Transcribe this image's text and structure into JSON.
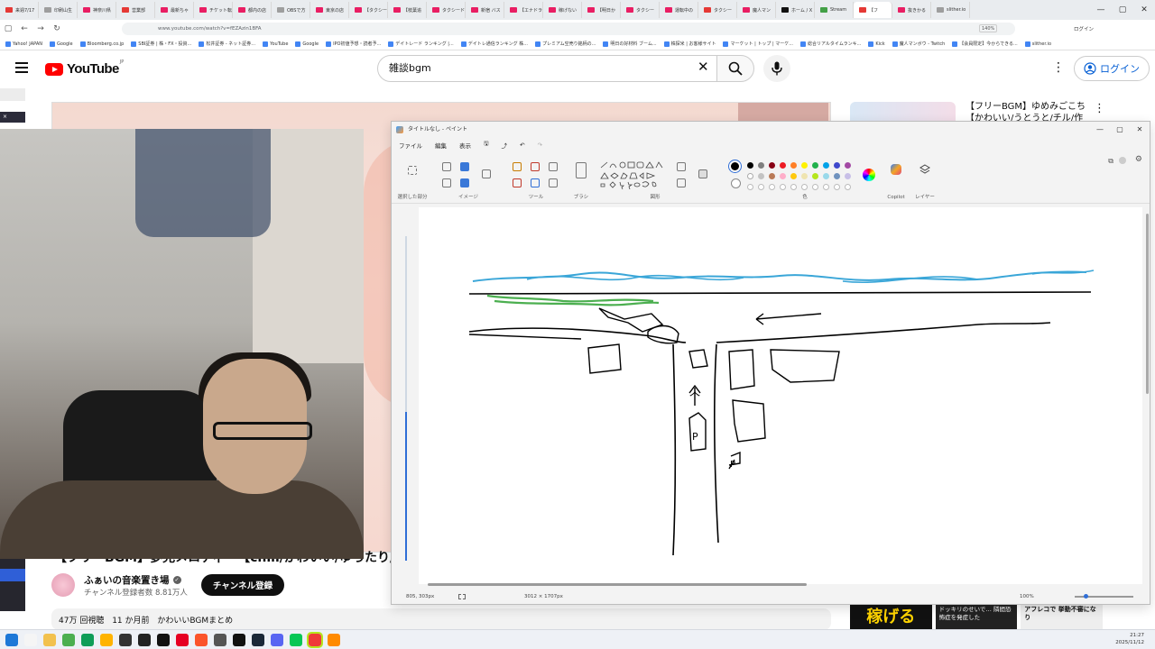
{
  "browser": {
    "tabs": [
      {
        "label": "来週7/17",
        "color": "#e53935"
      },
      {
        "label": "印刷山生",
        "color": "#9e9e9e"
      },
      {
        "label": "神奈川県",
        "color": "#e91e63"
      },
      {
        "label": "営業部",
        "color": "#e53935"
      },
      {
        "label": "最新ちゃ",
        "color": "#e91e63"
      },
      {
        "label": "チケット転",
        "color": "#e91e63"
      },
      {
        "label": "都内の店",
        "color": "#e91e63"
      },
      {
        "label": "OBSで方",
        "color": "#9e9e9e"
      },
      {
        "label": "東京の店",
        "color": "#e91e63"
      },
      {
        "label": "【タクシー",
        "color": "#e91e63"
      },
      {
        "label": "【枝葉追",
        "color": "#e91e63"
      },
      {
        "label": "タクシード",
        "color": "#e91e63"
      },
      {
        "label": "新宿 バス",
        "color": "#e91e63"
      },
      {
        "label": "【エナドラ",
        "color": "#e91e63"
      },
      {
        "label": "稼げない",
        "color": "#e91e63"
      },
      {
        "label": "【明日か",
        "color": "#e91e63"
      },
      {
        "label": "タクシー",
        "color": "#e91e63"
      },
      {
        "label": "運転中の",
        "color": "#e91e63"
      },
      {
        "label": "タクシー",
        "color": "#e53935"
      },
      {
        "label": "魔人マン",
        "color": "#e91e63"
      },
      {
        "label": "ホーム / X",
        "color": "#111111"
      },
      {
        "label": "Stream",
        "color": "#43a047"
      },
      {
        "label": "【フ",
        "color": "#e53935",
        "active": true
      },
      {
        "label": "抜きかる",
        "color": "#e91e63"
      },
      {
        "label": "slither.io",
        "color": "#9e9e9e"
      }
    ],
    "url": "www.youtube.com/watch?v=fEZAzin1BFA",
    "zoom": "140%",
    "profile_label": "ログイン",
    "bookmarks": [
      "Yahoo! JAPAN",
      "Google",
      "Bloomberg.co.jp",
      "SBI証券 | 株・FX・投資...",
      "松井証券 - ネット証券...",
      "YouTube",
      "Google",
      "IPO初値予想・読者予...",
      "デイトレード ランキング |...",
      "デイトレ通信ランキング 株...",
      "プレミアム空売り銘柄の...",
      "明日の好材料 ブーム...",
      "株探米 | お客様サイト",
      "マーケット | トップ | マーケ...",
      "総合リアルタイムランキ...",
      "Kick",
      "魔人マンボウ - Twitch",
      "【会員限定】今からできる...",
      "slither.io"
    ]
  },
  "youtube": {
    "logo_text": "YouTube",
    "region": "JP",
    "search_value": "雑談bgm",
    "login_label": "ログイン",
    "video_title": "【フリーBGM】夢見メロディー【chill/かわいい/ゆったり/",
    "channel_name": "ふぁいの音楽置き場",
    "subscriber_text": "チャンネル登録者数 8.81万人",
    "subscribe_label": "チャンネル登録",
    "views": "47万 回視聴",
    "posted": "11 か月前",
    "tags": "かわいいBGMまとめ",
    "rec_title": "【フリーBGM】ゆめみごこち【かわいい/うとうと/チル/作",
    "rec_bottom": [
      "稼げる",
      "ドッキリのせいで… 隣間恐怖症を発症した",
      "アフレコで 挙動不審になり"
    ]
  },
  "side_strip": {
    "label": "×"
  },
  "paint": {
    "title": "タイトルなし - ペイント",
    "menu": [
      "ファイル",
      "編集",
      "表示"
    ],
    "groups": [
      "選択した部分",
      "イメージ",
      "ツール",
      "ブラシ",
      "図形",
      "色",
      "Copilot",
      "レイヤー"
    ],
    "status_coord": "805, 303px",
    "status_dims": "3012 × 1707px",
    "status_zoom": "100%",
    "palette": [
      "#000000",
      "#7f7f7f",
      "#880015",
      "#ed1c24",
      "#ff7f27",
      "#fff200",
      "#22b14c",
      "#00a2e8",
      "#3f48cc",
      "#a349a4",
      "#ffffff",
      "#c3c3c3",
      "#b97a57",
      "#ffaec9",
      "#ffc90e",
      "#efe4b0",
      "#b5e61d",
      "#99d9ea",
      "#7092be",
      "#c8bfe7"
    ],
    "drawing": {
      "labels": [
        "个",
        "P",
        "P"
      ],
      "stroke_color": "#000000",
      "water_color": "#3aa6d8",
      "grass_color": "#4caf50"
    }
  },
  "taskbar": {
    "time": "21:27",
    "date": "2025/11/12",
    "icons": [
      "windows",
      "search",
      "folder",
      "chrome",
      "edge",
      "explorer",
      "terminal",
      "obs",
      "capcut",
      "pinterest",
      "brave",
      "vpn",
      "tiktok",
      "steam",
      "discord",
      "line",
      "vivaldi",
      "app-orange"
    ]
  }
}
